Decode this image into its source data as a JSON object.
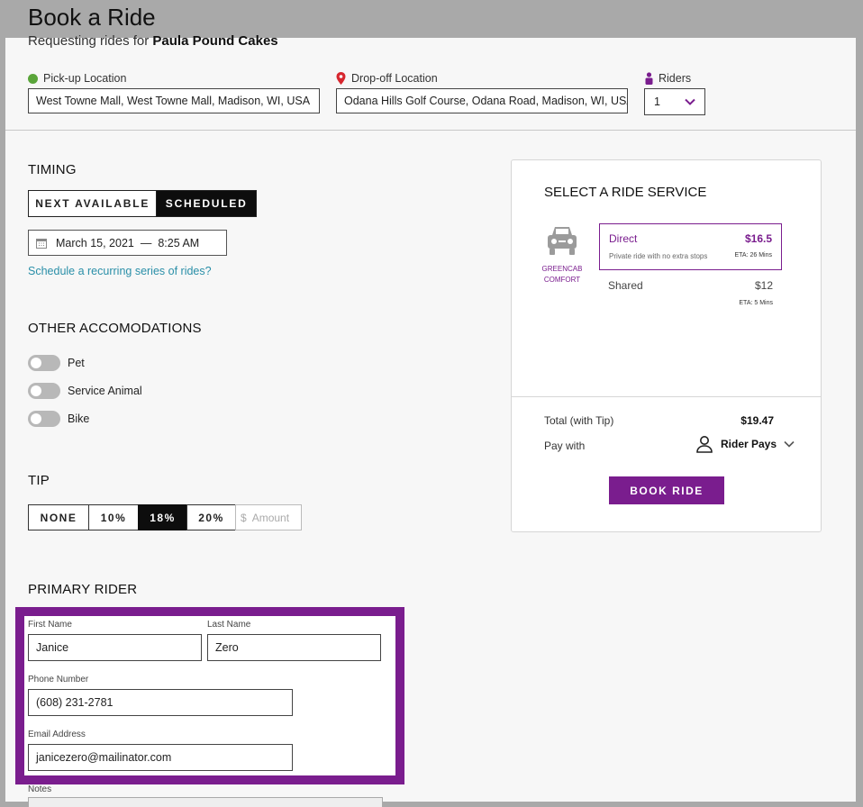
{
  "header": {
    "title": "Book a Ride",
    "subtitle_prefix": "Requesting rides for",
    "subtitle_name": "Paula Pound Cakes"
  },
  "pickup": {
    "label": "Pick-up Location",
    "value": "West Towne Mall, West Towne Mall, Madison, WI, USA"
  },
  "dropoff": {
    "label": "Drop-off Location",
    "value": "Odana Hills Golf Course, Odana Road, Madison, WI, USA"
  },
  "riders": {
    "label": "Riders",
    "value": "1"
  },
  "timing": {
    "title": "TIMING",
    "options": [
      "NEXT AVAILABLE",
      "SCHEDULED"
    ],
    "selected": "SCHEDULED",
    "date": "March 15, 2021",
    "separator": "—",
    "time": "8:25 AM",
    "recurring_link": "Schedule a recurring series of rides?"
  },
  "accommodations": {
    "title": "OTHER ACCOMODATIONS",
    "items": [
      {
        "label": "Pet",
        "enabled": false
      },
      {
        "label": "Service Animal",
        "enabled": false
      },
      {
        "label": "Bike",
        "enabled": false
      }
    ]
  },
  "tip": {
    "title": "TIP",
    "options": [
      "NONE",
      "10%",
      "18%",
      "20%"
    ],
    "selected": "18%",
    "amount_symbol": "$",
    "amount_placeholder": "Amount"
  },
  "primary_rider": {
    "title": "PRIMARY RIDER",
    "first_name_label": "First Name",
    "first_name": "Janice",
    "last_name_label": "Last Name",
    "last_name": "Zero",
    "phone_label": "Phone Number",
    "phone": "(608) 231-2781",
    "email_label": "Email Address",
    "email": "janicezero@mailinator.com",
    "notes_label": "Notes"
  },
  "ride_service": {
    "title": "SELECT A RIDE SERVICE",
    "provider_line1": "GREENCAB",
    "provider_line2": "COMFORT",
    "services": [
      {
        "name": "Direct",
        "price": "$16.5",
        "description": "Private ride with no extra stops",
        "eta": "ETA: 26 Mins",
        "selected": true
      },
      {
        "name": "Shared",
        "price": "$12",
        "description": "",
        "eta": "ETA: 5 Mins",
        "selected": false
      }
    ],
    "total_label": "Total (with Tip)",
    "total_value": "$19.47",
    "pay_label": "Pay with",
    "pay_value": "Rider Pays",
    "book_button": "BOOK RIDE"
  },
  "colors": {
    "accent": "#7a1d8e",
    "link": "#2a8fa8",
    "pickup_dot": "#5aa53a",
    "dropoff_pin": "#d7262e",
    "overlay": "#a9a9a9"
  },
  "icons": [
    "pickup-dot-icon",
    "dropoff-pin-icon",
    "rider-icon",
    "chevron-down-icon",
    "calendar-icon",
    "car-icon",
    "user-icon"
  ]
}
